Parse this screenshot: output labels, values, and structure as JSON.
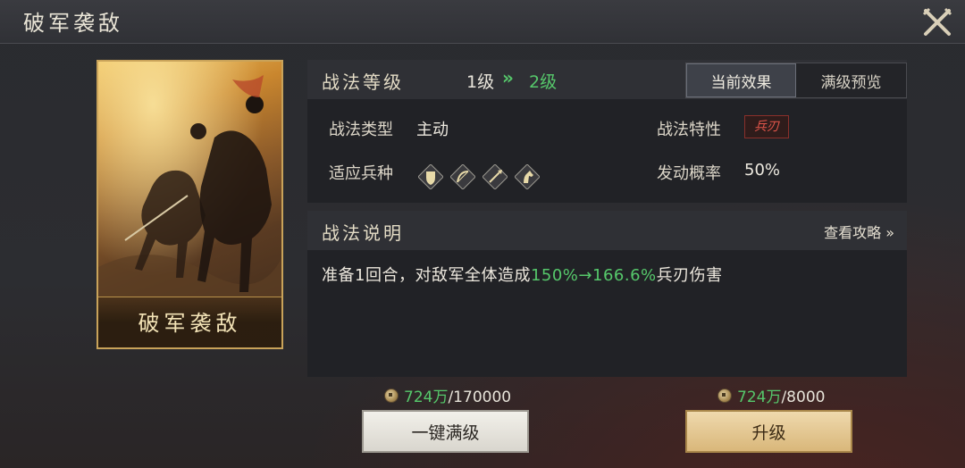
{
  "header": {
    "title": "破军袭敌",
    "close_icon": "close-swords-icon"
  },
  "card": {
    "name": "破军袭敌"
  },
  "level_panel": {
    "title": "战法等级",
    "level_from": "1级",
    "level_arrow": "»",
    "level_to": "2级",
    "tabs": [
      {
        "label": "当前效果",
        "active": true
      },
      {
        "label": "满级预览",
        "active": false
      }
    ]
  },
  "info": {
    "type_label": "战法类型",
    "type_value": "主动",
    "trait_label": "战法特性",
    "trait_badge": "兵刃",
    "troops_label": "适应兵种",
    "troop_icons": [
      "shield-icon",
      "bow-icon",
      "spear-icon",
      "horse-icon"
    ],
    "chance_label": "发动概率",
    "chance_value": "50%"
  },
  "description": {
    "title": "战法说明",
    "guide_link": "查看攻略 »",
    "text_prefix": "准备1回合，对敌军全体造成",
    "text_highlight": "150%→166.6%",
    "text_suffix": "兵刃伤害"
  },
  "costs": {
    "max": {
      "have": "724万",
      "need": "/170000"
    },
    "upgrade": {
      "have": "724万",
      "need": "/8000"
    }
  },
  "buttons": {
    "max_label": "一键满级",
    "upgrade_label": "升级"
  },
  "colors": {
    "accent_green": "#56c86b",
    "gold_border": "#c9a35a",
    "trait_red": "#e3564b"
  }
}
